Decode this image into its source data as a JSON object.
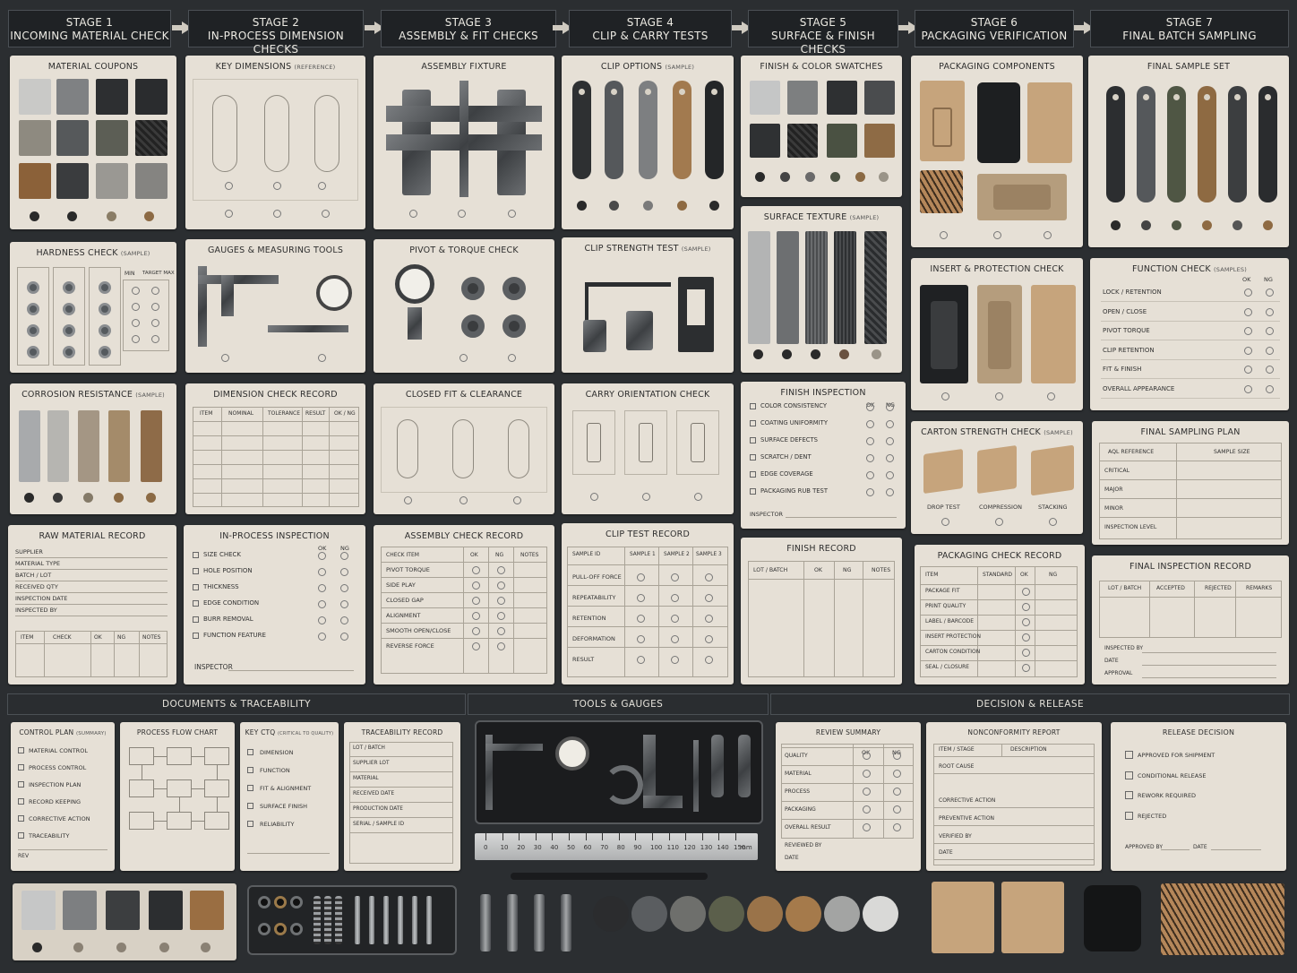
{
  "stages": [
    {
      "num": "STAGE 1",
      "name": "INCOMING MATERIAL CHECK"
    },
    {
      "num": "STAGE 2",
      "name": "IN-PROCESS DIMENSION CHECKS"
    },
    {
      "num": "STAGE 3",
      "name": "ASSEMBLY & FIT CHECKS"
    },
    {
      "num": "STAGE 4",
      "name": "CLIP & CARRY TESTS"
    },
    {
      "num": "STAGE 5",
      "name": "SURFACE & FINISH CHECKS"
    },
    {
      "num": "STAGE 6",
      "name": "PACKAGING VERIFICATION"
    },
    {
      "num": "STAGE 7",
      "name": "FINAL BATCH SAMPLING"
    }
  ],
  "cards": {
    "material_coupons": "MATERIAL COUPONS",
    "hardness": "HARDNESS CHECK",
    "hardness_tag": "(SAMPLE)",
    "hardness_min": "MIN",
    "hardness_target": "TARGET MAX",
    "corrosion": "CORROSION RESISTANCE",
    "corrosion_tag": "(SAMPLE)",
    "raw_record": "RAW MATERIAL RECORD",
    "raw_fields": [
      "SUPPLIER",
      "MATERIAL TYPE",
      "BATCH / LOT",
      "RECEIVED QTY",
      "INSPECTION DATE",
      "INSPECTED BY"
    ],
    "raw_cols": [
      "ITEM",
      "CHECK",
      "OK",
      "NG",
      "NOTES"
    ],
    "key_dims": "KEY DIMENSIONS",
    "key_dims_tag": "(REFERENCE)",
    "gauges": "GAUGES & MEASURING TOOLS",
    "dim_record": "DIMENSION CHECK RECORD",
    "dim_cols": [
      "ITEM",
      "NOMINAL",
      "TOLERANCE",
      "RESULT",
      "OK / NG"
    ],
    "inproc": "IN-PROCESS INSPECTION",
    "ok": "OK",
    "ng": "NG",
    "inproc_items": [
      "SIZE CHECK",
      "HOLE POSITION",
      "THICKNESS",
      "EDGE CONDITION",
      "BURR REMOVAL",
      "FUNCTION FEATURE"
    ],
    "inspector": "INSPECTOR",
    "assembly_fixture": "ASSEMBLY FIXTURE",
    "pivot": "PIVOT & TORQUE CHECK",
    "closed_fit": "CLOSED FIT & CLEARANCE",
    "assembly_record": "ASSEMBLY CHECK RECORD",
    "assembly_cols": [
      "CHECK ITEM",
      "OK",
      "NG",
      "NOTES"
    ],
    "assembly_items": [
      "PIVOT TORQUE",
      "SIDE PLAY",
      "CLOSED GAP",
      "ALIGNMENT",
      "SMOOTH OPEN/CLOSE",
      "REVERSE FORCE"
    ],
    "clip_options": "CLIP OPTIONS",
    "clip_options_tag": "(SAMPLE)",
    "clip_strength": "CLIP STRENGTH TEST",
    "clip_strength_tag": "(SAMPLE)",
    "carry": "CARRY ORIENTATION CHECK",
    "clip_record": "CLIP TEST RECORD",
    "clip_cols": [
      "SAMPLE ID",
      "SAMPLE 1",
      "SAMPLE 2",
      "SAMPLE 3"
    ],
    "clip_items": [
      "PULL-OFF FORCE",
      "REPEATABILITY",
      "RETENTION",
      "DEFORMATION",
      "RESULT"
    ],
    "finish_swatches": "FINISH & COLOR SWATCHES",
    "surface_texture": "SURFACE TEXTURE",
    "surface_texture_tag": "(SAMPLE)",
    "finish_inspection": "FINISH INSPECTION",
    "finish_items": [
      "COLOR CONSISTENCY",
      "COATING UNIFORMITY",
      "SURFACE DEFECTS",
      "SCRATCH / DENT",
      "EDGE COVERAGE",
      "PACKAGING RUB TEST"
    ],
    "finish_record": "FINISH RECORD",
    "finish_cols": [
      "LOT / BATCH",
      "OK",
      "NG",
      "NOTES"
    ],
    "pack_components": "PACKAGING COMPONENTS",
    "insert_check": "INSERT & PROTECTION CHECK",
    "carton": "CARTON STRENGTH CHECK",
    "carton_tag": "(SAMPLE)",
    "carton_labels": [
      "DROP TEST",
      "COMPRESSION",
      "STACKING"
    ],
    "pack_record": "PACKAGING CHECK RECORD",
    "pack_cols": [
      "ITEM",
      "STANDARD",
      "OK",
      "NG"
    ],
    "pack_items": [
      "PACKAGE FIT",
      "PRINT QUALITY",
      "LABEL / BARCODE",
      "INSERT PROTECTION",
      "CARTON CONDITION",
      "SEAL / CLOSURE"
    ],
    "final_sample": "FINAL SAMPLE SET",
    "function_check": "FUNCTION CHECK",
    "function_tag": "(SAMPLES)",
    "function_items": [
      "LOCK / RETENTION",
      "OPEN / CLOSE",
      "PIVOT TORQUE",
      "CLIP RETENTION",
      "FIT & FINISH",
      "OVERALL APPEARANCE"
    ],
    "sampling_plan": "FINAL SAMPLING PLAN",
    "sampling_cols": [
      "AQL REFERENCE",
      "SAMPLE SIZE"
    ],
    "sampling_rows": [
      "CRITICAL",
      "MAJOR",
      "MINOR",
      "INSPECTION LEVEL"
    ],
    "final_record": "FINAL INSPECTION RECORD",
    "final_cols": [
      "LOT / BATCH",
      "ACCEPTED",
      "REJECTED",
      "REMARKS"
    ],
    "final_sign": [
      "INSPECTED BY",
      "DATE",
      "APPROVAL"
    ]
  },
  "sections": {
    "docs": "DOCUMENTS & TRACEABILITY",
    "tools": "TOOLS & GAUGES",
    "decision": "DECISION & RELEASE"
  },
  "docs": {
    "control_plan": "CONTROL PLAN",
    "control_plan_tag": "(SUMMARY)",
    "control_items": [
      "MATERIAL CONTROL",
      "PROCESS CONTROL",
      "INSPECTION PLAN",
      "RECORD KEEPING",
      "CORRECTIVE ACTION",
      "TRACEABILITY"
    ],
    "rev": "REV",
    "flow": "PROCESS FLOW CHART",
    "ctq": "KEY CTQ",
    "ctq_tag": "(CRITICAL TO QUALITY)",
    "ctq_items": [
      "DIMENSION",
      "FUNCTION",
      "FIT & ALIGNMENT",
      "SURFACE FINISH",
      "RELIABILITY"
    ],
    "trace": "TRACEABILITY RECORD",
    "trace_items": [
      "LOT / BATCH",
      "SUPPLIER LOT",
      "MATERIAL",
      "RECEIVED DATE",
      "PRODUCTION DATE",
      "SERIAL / SAMPLE ID"
    ]
  },
  "ruler": [
    "0",
    "10",
    "20",
    "30",
    "40",
    "50",
    "60",
    "70",
    "80",
    "90",
    "100",
    "110",
    "120",
    "130",
    "140",
    "150",
    "mm"
  ],
  "decision": {
    "review": "REVIEW SUMMARY",
    "review_items": [
      "QUALITY",
      "MATERIAL",
      "PROCESS",
      "PACKAGING",
      "OVERALL RESULT"
    ],
    "review_sign": [
      "REVIEWED BY",
      "DATE"
    ],
    "ncr": "NONCONFORMITY REPORT",
    "ncr_cols": [
      "ITEM / STAGE",
      "DESCRIPTION"
    ],
    "ncr_items": [
      "ROOT CAUSE",
      "CORRECTIVE ACTION",
      "PREVENTIVE ACTION",
      "VERIFIED BY",
      "DATE"
    ],
    "release": "RELEASE DECISION",
    "release_items": [
      "APPROVED FOR SHIPMENT",
      "CONDITIONAL RELEASE",
      "REWORK REQUIRED",
      "REJECTED"
    ],
    "approved_by": "APPROVED BY",
    "date": "DATE"
  }
}
